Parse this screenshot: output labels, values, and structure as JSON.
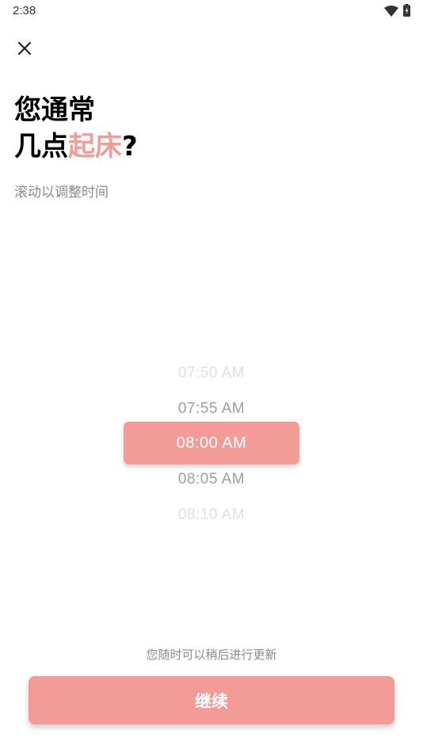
{
  "status_bar": {
    "time": "2:38",
    "wifi_icon": "wifi-icon",
    "battery_icon": "battery-charging-icon"
  },
  "close_icon": "close-icon",
  "title": {
    "line1": "您通常",
    "line2_prefix": "几点",
    "line2_accent": "起床",
    "line2_suffix": "?"
  },
  "subtitle": "滚动以调整时间",
  "picker": {
    "items": [
      "07:50 AM",
      "07:55 AM",
      "08:00 AM",
      "08:05 AM",
      "08:10 AM"
    ],
    "selected": "08:00 AM"
  },
  "note": "您随时可以稍后进行更新",
  "continue_button": {
    "label": "继续"
  },
  "colors": {
    "accent": "#F39C97",
    "muted_text": "#8a8a8a"
  }
}
